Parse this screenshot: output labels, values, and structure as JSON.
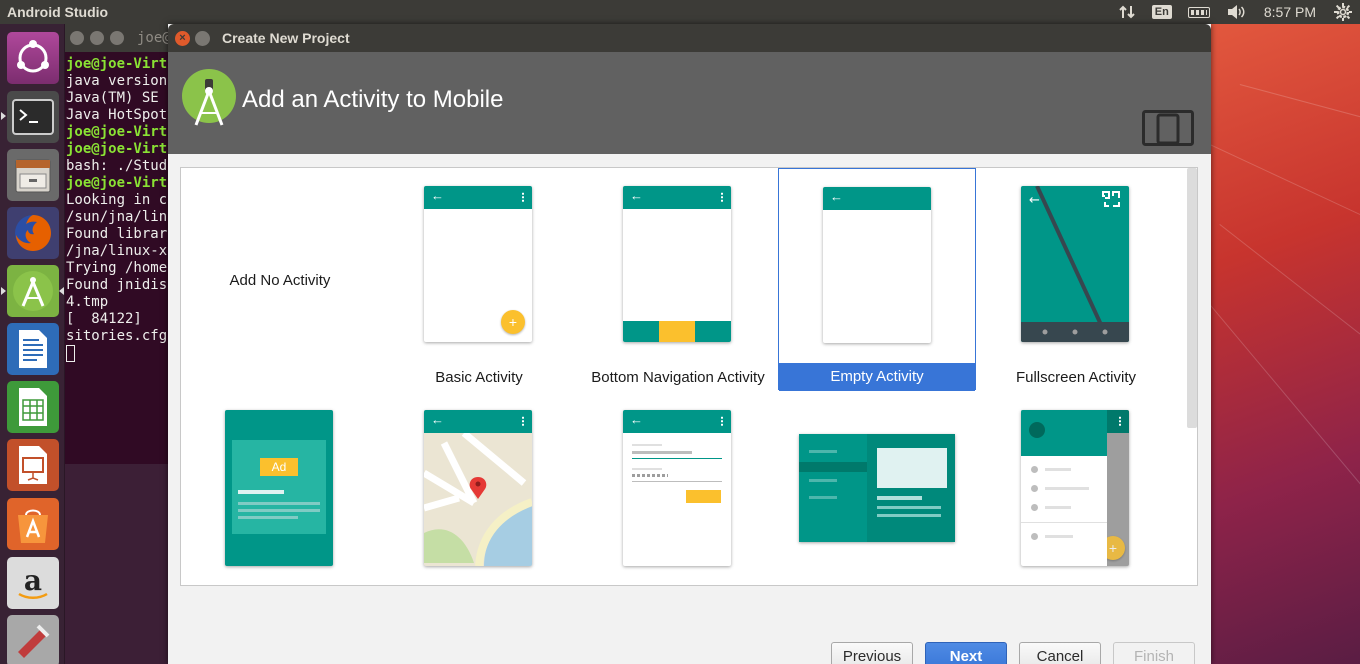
{
  "top_panel": {
    "app_name": "Android Studio",
    "language": "En",
    "clock": "8:57 PM"
  },
  "terminal": {
    "title": "joe@",
    "lines": [
      {
        "text": "joe@joe-Virt",
        "green": true
      },
      {
        "text": "java version",
        "green": false
      },
      {
        "text": "Java(TM) SE ",
        "green": false
      },
      {
        "text": "Java HotSpot",
        "green": false
      },
      {
        "text": "joe@joe-Virt",
        "green": true
      },
      {
        "text": "joe@joe-Virt",
        "green": true
      },
      {
        "text": "bash: ./Stud",
        "green": false
      },
      {
        "text": "joe@joe-Virt",
        "green": true
      },
      {
        "text": "Looking in c",
        "green": false
      },
      {
        "text": "/sun/jna/lin",
        "green": false
      },
      {
        "text": "Found librar",
        "green": false
      },
      {
        "text": "/jna/linux-x",
        "green": false
      },
      {
        "text": "Trying /home",
        "green": false
      },
      {
        "text": "Found jnidis",
        "green": false
      },
      {
        "text": "4.tmp",
        "green": false
      },
      {
        "text": "[  84122] ",
        "green": false
      },
      {
        "text": "sitories.cfg",
        "green": false
      }
    ]
  },
  "launcher": {
    "items": [
      {
        "name": "ubuntu-dash-icon"
      },
      {
        "name": "terminal-icon"
      },
      {
        "name": "file-manager-icon"
      },
      {
        "name": "firefox-icon"
      },
      {
        "name": "android-studio-icon"
      },
      {
        "name": "libreoffice-writer-icon"
      },
      {
        "name": "libreoffice-calc-icon"
      },
      {
        "name": "libreoffice-impress-icon"
      },
      {
        "name": "software-center-icon"
      },
      {
        "name": "amazon-icon"
      },
      {
        "name": "system-settings-icon"
      }
    ]
  },
  "dialog": {
    "window_title": "Create New Project",
    "header_title": "Add an Activity to Mobile",
    "accent": "#009688",
    "selected_color": "#3875d7",
    "activities": [
      {
        "label": "Add No Activity"
      },
      {
        "label": "Basic Activity"
      },
      {
        "label": "Bottom Navigation Activity"
      },
      {
        "label": "Empty Activity",
        "selected": true
      },
      {
        "label": "Fullscreen Activity"
      }
    ],
    "ad_badge": "Ad",
    "buttons": {
      "previous": "Previous",
      "next": "Next",
      "cancel": "Cancel",
      "finish": "Finish"
    }
  }
}
